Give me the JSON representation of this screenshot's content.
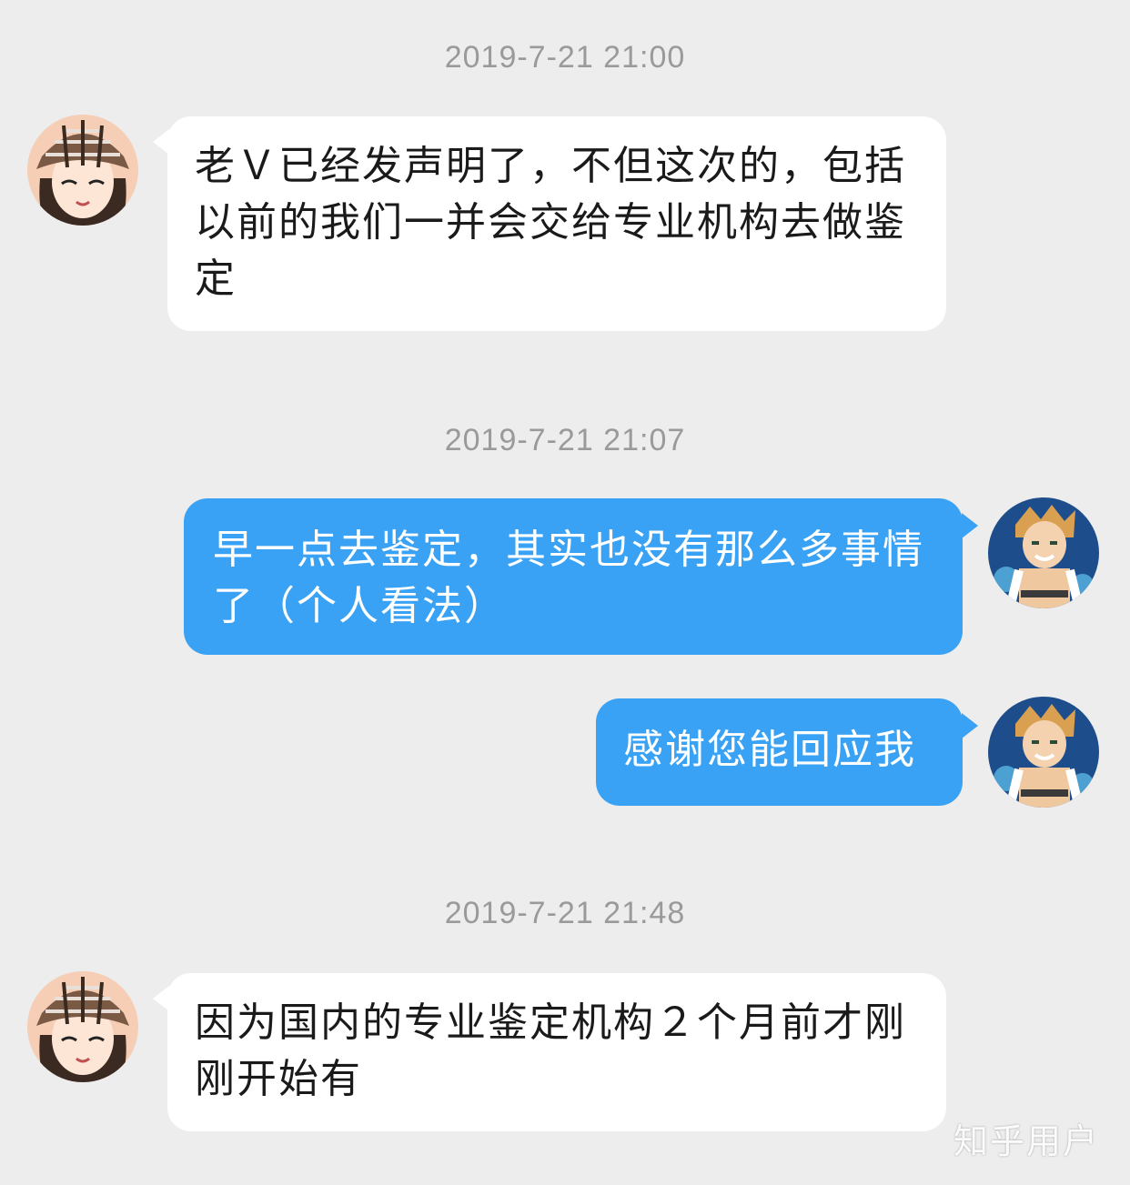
{
  "messages": [
    {
      "timestamp": "2019-7-21 21:00",
      "side": "left",
      "text": "老Ｖ已经发声明了，不但这次的，包括以前的我们一并会交给专业机构去做鉴定"
    },
    {
      "timestamp": "2019-7-21 21:07",
      "side": "right",
      "text": "早一点去鉴定，其实也没有那么多事情了（个人看法）"
    },
    {
      "timestamp": "",
      "side": "right",
      "text": "感谢您能回应我"
    },
    {
      "timestamp": "2019-7-21 21:48",
      "side": "left",
      "text": "因为国内的专业鉴定机构２个月前才刚刚开始有"
    }
  ],
  "avatars": {
    "contact": "girl-with-plaid-cap-avatar",
    "self": "anime-boy-avatar"
  },
  "watermark": "知乎用户",
  "colors": {
    "background": "#ededed",
    "incoming_bubble": "#ffffff",
    "outgoing_bubble": "#3aa2f4",
    "timestamp": "#9a9a9a"
  }
}
